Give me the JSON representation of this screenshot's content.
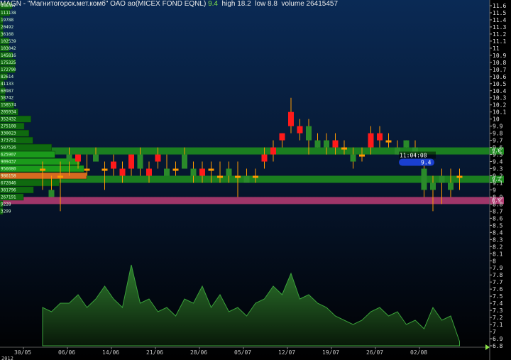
{
  "header": {
    "symbol": "MAGN",
    "separator": " - ",
    "name": "\"Магнитогорск.мет.комб\" ОАО ао(MICEX FOND EQNL)",
    "price": "9.4",
    "high": "high 18.2",
    "low": "low 8.8",
    "volume": "volume 26415457"
  },
  "last_quote": {
    "time": "11:04:08",
    "price": "9.4"
  },
  "colors": {
    "background_top": "#0a2a55",
    "background_bottom": "#000000",
    "candle_up": "#ff1a1a",
    "candle_down": "#2a8a2a",
    "candle_flat": "#ff9900",
    "band_green": "#1e8a1e",
    "band_pink": "#b03a70",
    "volume_area": "#1f5a1f",
    "quote_box": "#1a3fd0"
  },
  "chart_data": {
    "type": "candlestick",
    "y_axis_ticks": [
      "11.6",
      "11.5",
      "11.4",
      "11.3",
      "11.2",
      "11.1",
      "11",
      "10.9",
      "10.8",
      "10.7",
      "10.6",
      "10.5",
      "10.4",
      "10.3",
      "10.2",
      "10.1",
      "10",
      "9.9",
      "9.8",
      "9.7",
      "9.6",
      "9.5",
      "9.4",
      "9.3",
      "9.2",
      "9.1",
      "9",
      "8.9",
      "8.8",
      "8.7",
      "8.6",
      "8.5",
      "8.4",
      "8.3",
      "8.2",
      "8.1",
      "8",
      "7.9",
      "7.8",
      "7.7",
      "7.6",
      "7.5",
      "7.4",
      "7.3",
      "7.2",
      "7.1",
      "7",
      "6.9",
      "6.8"
    ],
    "y_range": [
      6.8,
      11.6
    ],
    "x_axis_ticks": [
      "30/05",
      "06/06",
      "14/06",
      "21/06",
      "28/06",
      "05/07",
      "12/07",
      "19/07",
      "26/07",
      "02/08"
    ],
    "x_axis_year": "2012",
    "bands": [
      {
        "low": 9.5,
        "high": 9.6,
        "color": "green",
        "label": "9.6"
      },
      {
        "low": 9.1,
        "high": 9.2,
        "color": "green",
        "label": "9.2"
      },
      {
        "low": 8.8,
        "high": 8.9,
        "color": "pink",
        "label": "8.9"
      }
    ],
    "volume_profile": [
      {
        "price": 11.6,
        "label": "136497",
        "value": 136497
      },
      {
        "price": 11.5,
        "label": "111138",
        "value": 111138
      },
      {
        "price": 11.4,
        "label": "19788",
        "value": 19788
      },
      {
        "price": 11.3,
        "label": "20492",
        "value": 20492
      },
      {
        "price": 11.2,
        "label": "36168",
        "value": 36168
      },
      {
        "price": 11.1,
        "label": "102539",
        "value": 102539
      },
      {
        "price": 11.0,
        "label": "103042",
        "value": 103042
      },
      {
        "price": 10.9,
        "label": "145816",
        "value": 145816
      },
      {
        "price": 10.8,
        "label": "175325",
        "value": 175325
      },
      {
        "price": 10.7,
        "label": "172790",
        "value": 172790
      },
      {
        "price": 10.6,
        "label": "82614",
        "value": 82614
      },
      {
        "price": 10.5,
        "label": "41133",
        "value": 41133
      },
      {
        "price": 10.4,
        "label": "60987",
        "value": 60987
      },
      {
        "price": 10.3,
        "label": "58742",
        "value": 58742
      },
      {
        "price": 10.2,
        "label": "158574",
        "value": 158574
      },
      {
        "price": 10.1,
        "label": "205934",
        "value": 205934
      },
      {
        "price": 10.0,
        "label": "352432",
        "value": 352432
      },
      {
        "price": 9.9,
        "label": "275108",
        "value": 275108
      },
      {
        "price": 9.8,
        "label": "330023",
        "value": 330023
      },
      {
        "price": 9.7,
        "label": "373751",
        "value": 373751
      },
      {
        "price": 9.6,
        "label": "587526",
        "value": 587526
      },
      {
        "price": 9.5,
        "label": "625907",
        "value": 625907
      },
      {
        "price": 9.4,
        "label": "909437",
        "value": 909437
      },
      {
        "price": 9.3,
        "label": "956080",
        "value": 956080
      },
      {
        "price": 9.2,
        "label": "986158",
        "value": 986158
      },
      {
        "price": 9.1,
        "label": "672846",
        "value": 672846
      },
      {
        "price": 9.0,
        "label": "381796",
        "value": 381796
      },
      {
        "price": 8.9,
        "label": "267191",
        "value": 267191
      },
      {
        "price": 8.8,
        "label": "9228",
        "value": 9228
      },
      {
        "price": 8.7,
        "label": "3299",
        "value": 3299
      }
    ],
    "candles": [
      {
        "i": 0,
        "o": 9.3,
        "h": 9.4,
        "l": 9.0,
        "c": 9.3
      },
      {
        "i": 1,
        "o": 9.0,
        "h": 9.2,
        "l": 8.9,
        "c": 8.9
      },
      {
        "i": 2,
        "o": 9.2,
        "h": 9.4,
        "l": 8.7,
        "c": 9.2
      },
      {
        "i": 3,
        "o": 9.5,
        "h": 9.6,
        "l": 9.2,
        "c": 9.4
      },
      {
        "i": 4,
        "o": 9.4,
        "h": 9.5,
        "l": 9.3,
        "c": 9.5
      },
      {
        "i": 5,
        "o": 9.3,
        "h": 9.5,
        "l": 9.2,
        "c": 9.3
      },
      {
        "i": 6,
        "o": 9.5,
        "h": 9.6,
        "l": 9.4,
        "c": 9.4
      },
      {
        "i": 7,
        "o": 9.3,
        "h": 9.4,
        "l": 9.0,
        "c": 9.3
      },
      {
        "i": 8,
        "o": 9.3,
        "h": 9.5,
        "l": 9.2,
        "c": 9.4
      },
      {
        "i": 9,
        "o": 9.2,
        "h": 9.4,
        "l": 9.1,
        "c": 9.3
      },
      {
        "i": 10,
        "o": 9.3,
        "h": 9.5,
        "l": 9.2,
        "c": 9.5
      },
      {
        "i": 11,
        "o": 9.5,
        "h": 9.6,
        "l": 9.2,
        "c": 9.3
      },
      {
        "i": 12,
        "o": 9.2,
        "h": 9.4,
        "l": 9.1,
        "c": 9.3
      },
      {
        "i": 13,
        "o": 9.4,
        "h": 9.6,
        "l": 9.3,
        "c": 9.5
      },
      {
        "i": 14,
        "o": 9.3,
        "h": 9.5,
        "l": 9.2,
        "c": 9.2
      },
      {
        "i": 15,
        "o": 9.3,
        "h": 9.4,
        "l": 9.2,
        "c": 9.3
      },
      {
        "i": 16,
        "o": 9.5,
        "h": 9.6,
        "l": 9.3,
        "c": 9.3
      },
      {
        "i": 17,
        "o": 9.3,
        "h": 9.4,
        "l": 9.1,
        "c": 9.2
      },
      {
        "i": 18,
        "o": 9.2,
        "h": 9.4,
        "l": 9.1,
        "c": 9.3
      },
      {
        "i": 19,
        "o": 9.3,
        "h": 9.4,
        "l": 9.1,
        "c": 9.3
      },
      {
        "i": 20,
        "o": 9.2,
        "h": 9.4,
        "l": 9.1,
        "c": 9.2
      },
      {
        "i": 21,
        "o": 9.3,
        "h": 9.4,
        "l": 9.1,
        "c": 9.2
      },
      {
        "i": 22,
        "o": 9.2,
        "h": 9.4,
        "l": 8.9,
        "c": 9.2
      },
      {
        "i": 23,
        "o": 9.2,
        "h": 9.3,
        "l": 9.1,
        "c": 9.1
      },
      {
        "i": 24,
        "o": 9.2,
        "h": 9.3,
        "l": 9.1,
        "c": 9.2
      },
      {
        "i": 25,
        "o": 9.4,
        "h": 9.6,
        "l": 9.3,
        "c": 9.5
      },
      {
        "i": 26,
        "o": 9.5,
        "h": 9.7,
        "l": 9.4,
        "c": 9.6
      },
      {
        "i": 27,
        "o": 9.7,
        "h": 9.8,
        "l": 9.6,
        "c": 9.8
      },
      {
        "i": 28,
        "o": 9.9,
        "h": 10.3,
        "l": 9.8,
        "c": 10.1
      },
      {
        "i": 29,
        "o": 9.8,
        "h": 10.0,
        "l": 9.7,
        "c": 9.9
      },
      {
        "i": 30,
        "o": 9.9,
        "h": 10.0,
        "l": 9.5,
        "c": 9.7
      },
      {
        "i": 31,
        "o": 9.7,
        "h": 9.8,
        "l": 9.6,
        "c": 9.6
      },
      {
        "i": 32,
        "o": 9.7,
        "h": 9.8,
        "l": 9.5,
        "c": 9.6
      },
      {
        "i": 33,
        "o": 9.6,
        "h": 9.8,
        "l": 9.5,
        "c": 9.7
      },
      {
        "i": 34,
        "o": 9.6,
        "h": 9.7,
        "l": 9.5,
        "c": 9.6
      },
      {
        "i": 35,
        "o": 9.5,
        "h": 9.6,
        "l": 9.3,
        "c": 9.4
      },
      {
        "i": 36,
        "o": 9.5,
        "h": 9.6,
        "l": 9.4,
        "c": 9.5
      },
      {
        "i": 37,
        "o": 9.6,
        "h": 9.9,
        "l": 9.5,
        "c": 9.8
      },
      {
        "i": 38,
        "o": 9.7,
        "h": 9.9,
        "l": 9.6,
        "c": 9.8
      },
      {
        "i": 39,
        "o": 9.7,
        "h": 9.8,
        "l": 9.6,
        "c": 9.7
      },
      {
        "i": 40,
        "o": 9.6,
        "h": 9.7,
        "l": 9.5,
        "c": 9.5
      },
      {
        "i": 41,
        "o": 9.7,
        "h": 9.7,
        "l": 9.6,
        "c": 9.6
      },
      {
        "i": 42,
        "o": 9.6,
        "h": 9.7,
        "l": 9.5,
        "c": 9.5
      },
      {
        "i": 43,
        "o": 9.3,
        "h": 9.4,
        "l": 8.9,
        "c": 9.0
      },
      {
        "i": 44,
        "o": 9.1,
        "h": 9.2,
        "l": 8.7,
        "c": 9.0
      },
      {
        "i": 45,
        "o": 9.2,
        "h": 9.3,
        "l": 8.8,
        "c": 9.1
      },
      {
        "i": 46,
        "o": 9.1,
        "h": 9.3,
        "l": 8.9,
        "c": 9.0
      },
      {
        "i": 47,
        "o": 9.2,
        "h": 9.3,
        "l": 9.0,
        "c": 9.2
      }
    ],
    "volume_series": [
      {
        "i": 0,
        "v": 0.45
      },
      {
        "i": 1,
        "v": 0.4
      },
      {
        "i": 2,
        "v": 0.5
      },
      {
        "i": 3,
        "v": 0.5
      },
      {
        "i": 4,
        "v": 0.6
      },
      {
        "i": 5,
        "v": 0.45
      },
      {
        "i": 6,
        "v": 0.55
      },
      {
        "i": 7,
        "v": 0.7
      },
      {
        "i": 8,
        "v": 0.55
      },
      {
        "i": 9,
        "v": 0.45
      },
      {
        "i": 10,
        "v": 0.95
      },
      {
        "i": 11,
        "v": 0.5
      },
      {
        "i": 12,
        "v": 0.55
      },
      {
        "i": 13,
        "v": 0.4
      },
      {
        "i": 14,
        "v": 0.45
      },
      {
        "i": 15,
        "v": 0.35
      },
      {
        "i": 16,
        "v": 0.55
      },
      {
        "i": 17,
        "v": 0.5
      },
      {
        "i": 18,
        "v": 0.7
      },
      {
        "i": 19,
        "v": 0.45
      },
      {
        "i": 20,
        "v": 0.6
      },
      {
        "i": 21,
        "v": 0.4
      },
      {
        "i": 22,
        "v": 0.45
      },
      {
        "i": 23,
        "v": 0.35
      },
      {
        "i": 24,
        "v": 0.5
      },
      {
        "i": 25,
        "v": 0.55
      },
      {
        "i": 26,
        "v": 0.7
      },
      {
        "i": 27,
        "v": 0.6
      },
      {
        "i": 28,
        "v": 0.85
      },
      {
        "i": 29,
        "v": 0.55
      },
      {
        "i": 30,
        "v": 0.6
      },
      {
        "i": 31,
        "v": 0.5
      },
      {
        "i": 32,
        "v": 0.45
      },
      {
        "i": 33,
        "v": 0.35
      },
      {
        "i": 34,
        "v": 0.3
      },
      {
        "i": 35,
        "v": 0.25
      },
      {
        "i": 36,
        "v": 0.3
      },
      {
        "i": 37,
        "v": 0.4
      },
      {
        "i": 38,
        "v": 0.45
      },
      {
        "i": 39,
        "v": 0.35
      },
      {
        "i": 40,
        "v": 0.4
      },
      {
        "i": 41,
        "v": 0.25
      },
      {
        "i": 42,
        "v": 0.3
      },
      {
        "i": 43,
        "v": 0.2
      },
      {
        "i": 44,
        "v": 0.45
      },
      {
        "i": 45,
        "v": 0.3
      },
      {
        "i": 46,
        "v": 0.35
      },
      {
        "i": 47,
        "v": 0.05
      }
    ]
  }
}
